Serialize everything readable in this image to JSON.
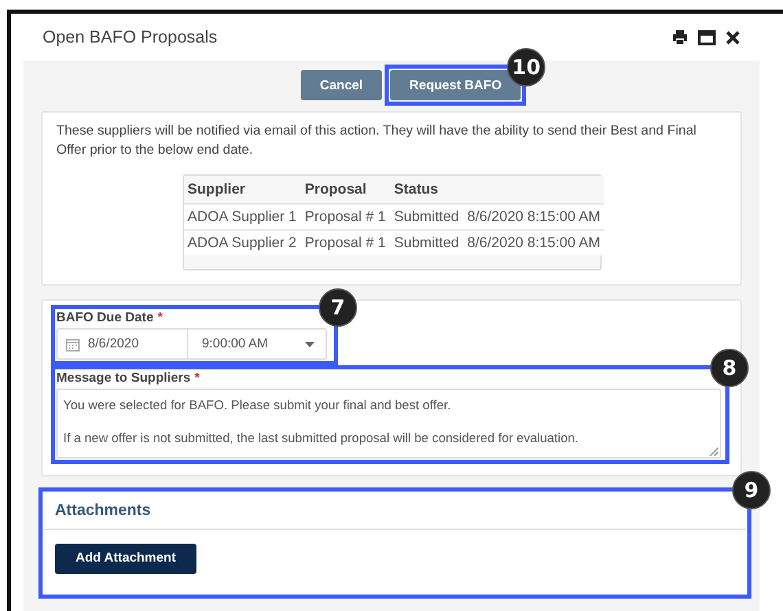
{
  "window": {
    "title": "Open BAFO Proposals"
  },
  "buttons": [
    {
      "label": "Cancel"
    },
    {
      "label": "Request BAFO"
    }
  ],
  "notice": "These suppliers will be notified via email of this action. They will have the ability to send their Best and Final Offer prior to the below end date.",
  "table": {
    "columns": [
      "Supplier",
      "Proposal",
      "Status"
    ],
    "rows": [
      [
        "ADOA Supplier 1",
        "Proposal # 1",
        "Submitted",
        "8/6/2020 8:15:00 AM"
      ],
      [
        "ADOA Supplier 2",
        "Proposal # 1",
        "Submitted",
        "8/6/2020 8:15:00 AM"
      ]
    ]
  },
  "due_date": {
    "label": "BAFO Due Date",
    "required_mark": "*",
    "date": "8/6/2020",
    "time": "9:00:00 AM"
  },
  "message": {
    "label": "Message to Suppliers",
    "required_mark": "*",
    "paragraphs": [
      "You were selected for BAFO. Please submit your final and best offer.",
      "If a new offer is not submitted, the last submitted proposal will be considered for evaluation."
    ]
  },
  "attachments": {
    "title": "Attachments",
    "button": "Add Attachment"
  },
  "callouts": [
    {
      "label": "10"
    },
    {
      "label": "7"
    },
    {
      "label": "8"
    },
    {
      "label": "9"
    }
  ]
}
